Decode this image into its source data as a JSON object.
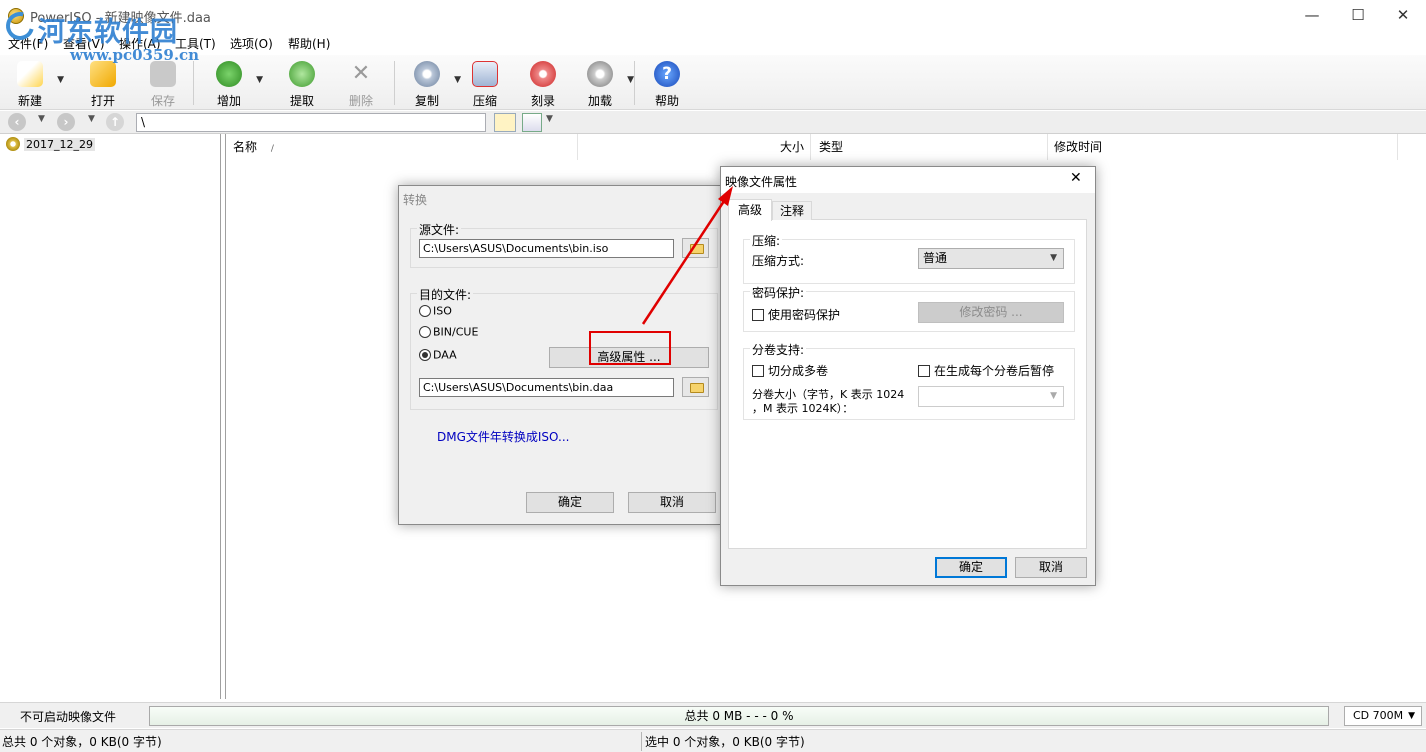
{
  "window": {
    "title": "PowerISO - 新建映像文件.daa",
    "minimize": "—",
    "maximize": "☐",
    "close": "✕"
  },
  "watermark": {
    "name": "河东软件园",
    "url": "www.pc0359.cn"
  },
  "menu": {
    "file": "文件(F)",
    "view": "查看(V)",
    "action": "操作(A)",
    "tools": "工具(T)",
    "options": "选项(O)",
    "help": "帮助(H)"
  },
  "toolbar": {
    "new": "新建",
    "open": "打开",
    "save": "保存",
    "add": "增加",
    "extract": "提取",
    "delete": "删除",
    "copy": "复制",
    "compress": "压缩",
    "burn": "刻录",
    "mount": "加载",
    "help": "帮助"
  },
  "address": {
    "path": "\\"
  },
  "tree": {
    "root": "2017_12_29"
  },
  "filelist": {
    "columns": {
      "name": "名称",
      "size": "大小",
      "type": "类型",
      "modified": "修改时间"
    },
    "sort_indicator": "/"
  },
  "status": {
    "boot": "不可启动映像文件",
    "total": "总共  0 MB   - - -  0 %",
    "disc": "CD 700M",
    "info_left": "总共 0 个对象，0 KB(0 字节)",
    "info_right": "选中 0 个对象，0 KB(0 字节)"
  },
  "convert_dialog": {
    "title": "转换",
    "source_label": "源文件:",
    "source_path": "C:\\Users\\ASUS\\Documents\\bin.iso",
    "dest_label": "目的文件:",
    "format_iso": "ISO",
    "format_bincue": "BIN/CUE",
    "format_daa": "DAA",
    "selected_format": "DAA",
    "advanced_button": "高级属性 ...",
    "dest_path": "C:\\Users\\ASUS\\Documents\\bin.daa",
    "dmg_link": "DMG文件年转换成ISO...",
    "ok": "确定",
    "cancel": "取消"
  },
  "props_dialog": {
    "title": "映像文件属性",
    "close": "✕",
    "tab_advanced": "高级",
    "tab_comment": "注释",
    "compression_group": "压缩:",
    "compression_method_label": "压缩方式:",
    "compression_method_value": "普通",
    "password_group": "密码保护:",
    "use_password": "使用密码保护",
    "change_password": "修改密码 ...",
    "split_group": "分卷支持:",
    "split_multi": "切分成多卷",
    "pause_after_volume": "在生成每个分卷后暂停",
    "volume_size_label_1": "分卷大小（字节，K 表示 1024",
    "volume_size_label_2": "，M 表示 1024K）：",
    "volume_size_value": "",
    "ok": "确定",
    "cancel": "取消"
  },
  "colors": {
    "annotation": "#e00000",
    "link": "#0000c0",
    "accent": "#0078d7"
  }
}
